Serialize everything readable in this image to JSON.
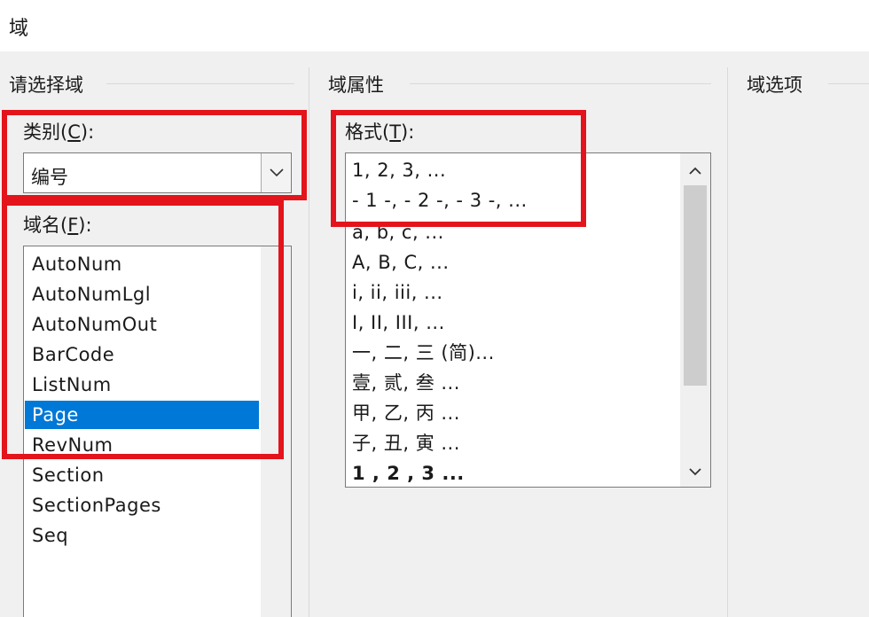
{
  "dialog": {
    "title": "域"
  },
  "groups": {
    "choose_field": "请选择域",
    "field_properties": "域属性",
    "field_options": "域选项"
  },
  "category": {
    "label_prefix": "类别(",
    "accesskey": "C",
    "label_suffix": "):",
    "selected": "编号",
    "dropdown_icon": "chevron-down-icon"
  },
  "field_names": {
    "label_prefix": "域名(",
    "accesskey": "F",
    "label_suffix": "):",
    "items": [
      "AutoNum",
      "AutoNumLgl",
      "AutoNumOut",
      "BarCode",
      "ListNum",
      "Page",
      "RevNum",
      "Section",
      "SectionPages",
      "Seq"
    ],
    "selected": "Page"
  },
  "format": {
    "label_prefix": "格式(",
    "accesskey": "T",
    "label_suffix": "):",
    "items": [
      "1, 2, 3, ...",
      "- 1 -, - 2 -, - 3 -, ...",
      "a, b, c, ...",
      "A, B, C, ...",
      "i, ii, iii, ...",
      "I, II, III, ...",
      "一, 二, 三 (简)...",
      "壹, 贰, 叁 ...",
      "甲, 乙, 丙 ...",
      "子, 丑, 寅 ...",
      "1 , 2 , 3  ..."
    ],
    "scroll_up_icon": "chevron-up-icon",
    "scroll_down_icon": "chevron-down-icon"
  },
  "highlight_color": "#e3141b",
  "selection_color": "#0078d7"
}
